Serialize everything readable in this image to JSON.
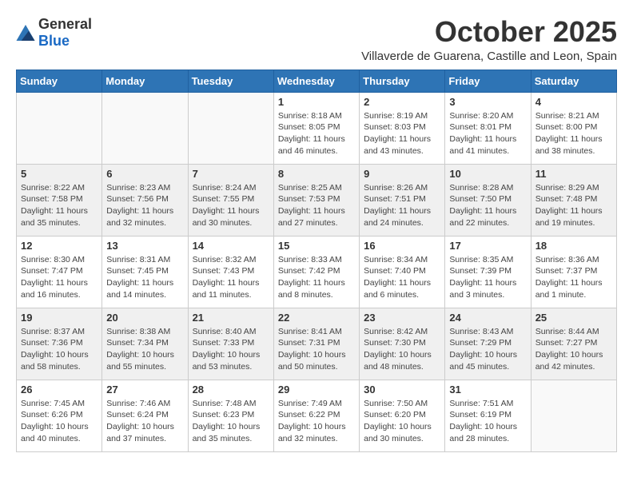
{
  "header": {
    "logo_general": "General",
    "logo_blue": "Blue",
    "month": "October 2025",
    "location": "Villaverde de Guarena, Castille and Leon, Spain"
  },
  "days_of_week": [
    "Sunday",
    "Monday",
    "Tuesday",
    "Wednesday",
    "Thursday",
    "Friday",
    "Saturday"
  ],
  "weeks": [
    [
      {
        "day": "",
        "info": ""
      },
      {
        "day": "",
        "info": ""
      },
      {
        "day": "",
        "info": ""
      },
      {
        "day": "1",
        "info": "Sunrise: 8:18 AM\nSunset: 8:05 PM\nDaylight: 11 hours\nand 46 minutes."
      },
      {
        "day": "2",
        "info": "Sunrise: 8:19 AM\nSunset: 8:03 PM\nDaylight: 11 hours\nand 43 minutes."
      },
      {
        "day": "3",
        "info": "Sunrise: 8:20 AM\nSunset: 8:01 PM\nDaylight: 11 hours\nand 41 minutes."
      },
      {
        "day": "4",
        "info": "Sunrise: 8:21 AM\nSunset: 8:00 PM\nDaylight: 11 hours\nand 38 minutes."
      }
    ],
    [
      {
        "day": "5",
        "info": "Sunrise: 8:22 AM\nSunset: 7:58 PM\nDaylight: 11 hours\nand 35 minutes."
      },
      {
        "day": "6",
        "info": "Sunrise: 8:23 AM\nSunset: 7:56 PM\nDaylight: 11 hours\nand 32 minutes."
      },
      {
        "day": "7",
        "info": "Sunrise: 8:24 AM\nSunset: 7:55 PM\nDaylight: 11 hours\nand 30 minutes."
      },
      {
        "day": "8",
        "info": "Sunrise: 8:25 AM\nSunset: 7:53 PM\nDaylight: 11 hours\nand 27 minutes."
      },
      {
        "day": "9",
        "info": "Sunrise: 8:26 AM\nSunset: 7:51 PM\nDaylight: 11 hours\nand 24 minutes."
      },
      {
        "day": "10",
        "info": "Sunrise: 8:28 AM\nSunset: 7:50 PM\nDaylight: 11 hours\nand 22 minutes."
      },
      {
        "day": "11",
        "info": "Sunrise: 8:29 AM\nSunset: 7:48 PM\nDaylight: 11 hours\nand 19 minutes."
      }
    ],
    [
      {
        "day": "12",
        "info": "Sunrise: 8:30 AM\nSunset: 7:47 PM\nDaylight: 11 hours\nand 16 minutes."
      },
      {
        "day": "13",
        "info": "Sunrise: 8:31 AM\nSunset: 7:45 PM\nDaylight: 11 hours\nand 14 minutes."
      },
      {
        "day": "14",
        "info": "Sunrise: 8:32 AM\nSunset: 7:43 PM\nDaylight: 11 hours\nand 11 minutes."
      },
      {
        "day": "15",
        "info": "Sunrise: 8:33 AM\nSunset: 7:42 PM\nDaylight: 11 hours\nand 8 minutes."
      },
      {
        "day": "16",
        "info": "Sunrise: 8:34 AM\nSunset: 7:40 PM\nDaylight: 11 hours\nand 6 minutes."
      },
      {
        "day": "17",
        "info": "Sunrise: 8:35 AM\nSunset: 7:39 PM\nDaylight: 11 hours\nand 3 minutes."
      },
      {
        "day": "18",
        "info": "Sunrise: 8:36 AM\nSunset: 7:37 PM\nDaylight: 11 hours\nand 1 minute."
      }
    ],
    [
      {
        "day": "19",
        "info": "Sunrise: 8:37 AM\nSunset: 7:36 PM\nDaylight: 10 hours\nand 58 minutes."
      },
      {
        "day": "20",
        "info": "Sunrise: 8:38 AM\nSunset: 7:34 PM\nDaylight: 10 hours\nand 55 minutes."
      },
      {
        "day": "21",
        "info": "Sunrise: 8:40 AM\nSunset: 7:33 PM\nDaylight: 10 hours\nand 53 minutes."
      },
      {
        "day": "22",
        "info": "Sunrise: 8:41 AM\nSunset: 7:31 PM\nDaylight: 10 hours\nand 50 minutes."
      },
      {
        "day": "23",
        "info": "Sunrise: 8:42 AM\nSunset: 7:30 PM\nDaylight: 10 hours\nand 48 minutes."
      },
      {
        "day": "24",
        "info": "Sunrise: 8:43 AM\nSunset: 7:29 PM\nDaylight: 10 hours\nand 45 minutes."
      },
      {
        "day": "25",
        "info": "Sunrise: 8:44 AM\nSunset: 7:27 PM\nDaylight: 10 hours\nand 42 minutes."
      }
    ],
    [
      {
        "day": "26",
        "info": "Sunrise: 7:45 AM\nSunset: 6:26 PM\nDaylight: 10 hours\nand 40 minutes."
      },
      {
        "day": "27",
        "info": "Sunrise: 7:46 AM\nSunset: 6:24 PM\nDaylight: 10 hours\nand 37 minutes."
      },
      {
        "day": "28",
        "info": "Sunrise: 7:48 AM\nSunset: 6:23 PM\nDaylight: 10 hours\nand 35 minutes."
      },
      {
        "day": "29",
        "info": "Sunrise: 7:49 AM\nSunset: 6:22 PM\nDaylight: 10 hours\nand 32 minutes."
      },
      {
        "day": "30",
        "info": "Sunrise: 7:50 AM\nSunset: 6:20 PM\nDaylight: 10 hours\nand 30 minutes."
      },
      {
        "day": "31",
        "info": "Sunrise: 7:51 AM\nSunset: 6:19 PM\nDaylight: 10 hours\nand 28 minutes."
      },
      {
        "day": "",
        "info": ""
      }
    ]
  ]
}
